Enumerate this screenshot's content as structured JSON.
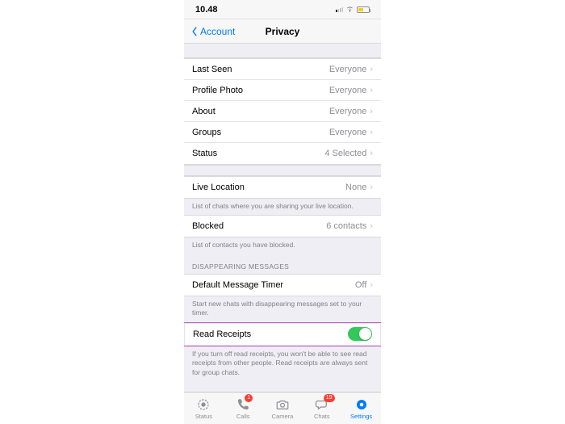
{
  "status": {
    "time": "10.48"
  },
  "nav": {
    "back": "Account",
    "title": "Privacy"
  },
  "rows": {
    "lastSeen": {
      "label": "Last Seen",
      "value": "Everyone"
    },
    "profilePhoto": {
      "label": "Profile Photo",
      "value": "Everyone"
    },
    "about": {
      "label": "About",
      "value": "Everyone"
    },
    "groups": {
      "label": "Groups",
      "value": "Everyone"
    },
    "status": {
      "label": "Status",
      "value": "4 Selected"
    },
    "liveLocation": {
      "label": "Live Location",
      "value": "None"
    },
    "blocked": {
      "label": "Blocked",
      "value": "6 contacts"
    },
    "defaultTimer": {
      "label": "Default Message Timer",
      "value": "Off"
    },
    "readReceipts": {
      "label": "Read Receipts"
    }
  },
  "footers": {
    "liveLocation": "List of chats where you are sharing your live location.",
    "blocked": "List of contacts you have blocked.",
    "defaultTimer": "Start new chats with disappearing messages set to your timer.",
    "readReceipts": "If you turn off read receipts, you won't be able to see read receipts from other people. Read receipts are always sent for group chats."
  },
  "headers": {
    "disappearing": "DISAPPEARING MESSAGES"
  },
  "tabs": {
    "status": {
      "label": "Status"
    },
    "calls": {
      "label": "Calls",
      "badge": "1"
    },
    "camera": {
      "label": "Camera"
    },
    "chats": {
      "label": "Chats",
      "badge": "19"
    },
    "settings": {
      "label": "Settings"
    }
  }
}
